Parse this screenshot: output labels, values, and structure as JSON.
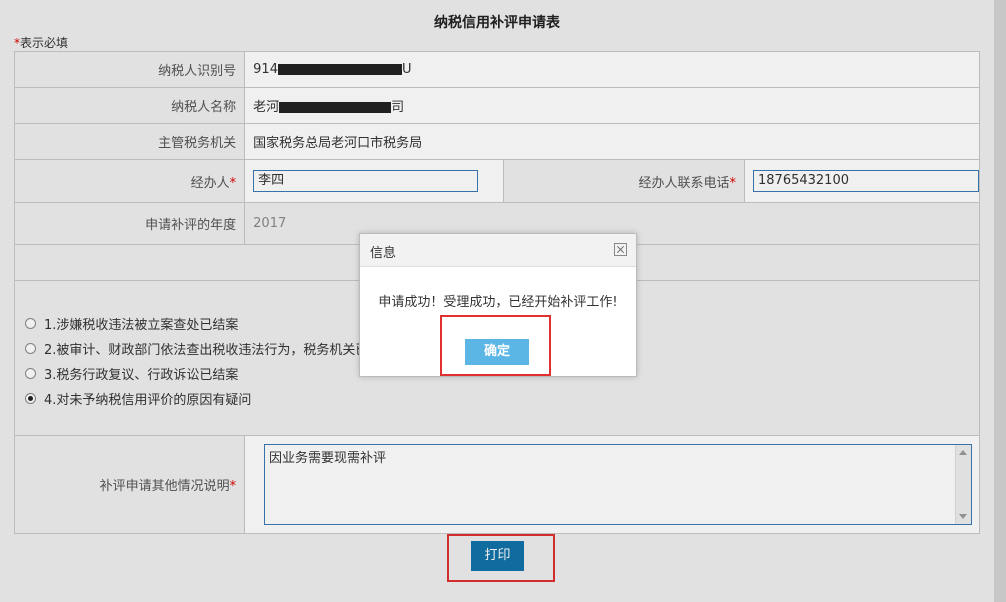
{
  "form": {
    "title": "纳税信用补评申请表",
    "required_note": "表示必填",
    "required_star": "*",
    "rows": {
      "taxpayer_id_label": "纳税人识别号",
      "taxpayer_id_prefix": "914",
      "taxpayer_id_suffix": "U",
      "taxpayer_name_label": "纳税人名称",
      "taxpayer_name_prefix": "老河",
      "taxpayer_name_suffix": "司",
      "tax_authority_label": "主管税务机关",
      "tax_authority_value": "国家税务总局老河口市税务局",
      "handler_label": "经办人",
      "handler_value": "李四",
      "handler_phone_label": "经办人联系电话",
      "handler_phone_value": "18765432100",
      "year_label": "申请补评的年度",
      "year_value": "2017"
    },
    "reasons": [
      {
        "label": "1.涉嫌税收违法被立案查处已结案",
        "checked": false
      },
      {
        "label": "2.被审计、财政部门依法查出税收违法行为，税务机关已",
        "checked": false
      },
      {
        "label": "3.税务行政复议、行政诉讼已结案",
        "checked": false
      },
      {
        "label": "4.对未予纳税信用评价的原因有疑问",
        "checked": true
      }
    ],
    "explanation_label": "补评申请其他情况说明",
    "explanation_value": "因业务需要现需补评",
    "print_button": "打印"
  },
  "dialog": {
    "title": "信息",
    "message": "申请成功！受理成功，已经开始补评工作!",
    "ok_button": "确定"
  },
  "colors": {
    "primary_button": "#1172a9",
    "dialog_button": "#5bb6e6",
    "highlight_border": "#e03030",
    "required_star": "#dd0000",
    "input_border": "#3d7ab6"
  }
}
